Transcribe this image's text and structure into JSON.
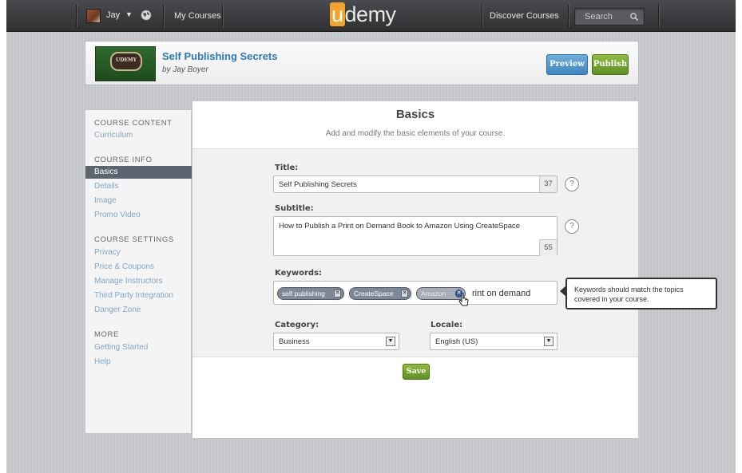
{
  "topbar": {
    "user_name": "Jay",
    "my_courses": "My Courses",
    "logo_u": "u",
    "logo_rest": "demy",
    "discover": "Discover Courses",
    "search_label": "Search"
  },
  "course": {
    "title": "Self Publishing Secrets",
    "author": "by Jay Boyer",
    "thumb_text": "UDEMY",
    "preview_label": "Preview",
    "publish_label": "Publish"
  },
  "sidebar": {
    "sections": [
      {
        "heading": "COURSE CONTENT",
        "items": [
          "Curriculum"
        ]
      },
      {
        "heading": "COURSE INFO",
        "items": [
          "Basics",
          "Details",
          "Image",
          "Promo Video"
        ]
      },
      {
        "heading": "COURSE SETTINGS",
        "items": [
          "Privacy",
          "Price & Coupons",
          "Manage Instructors",
          "Third Party Integration",
          "Danger Zone"
        ]
      },
      {
        "heading": "MORE",
        "items": [
          "Getting Started",
          "Help"
        ]
      }
    ],
    "active_item": "Basics"
  },
  "main": {
    "title": "Basics",
    "subtitle": "Add and modify the basic elements of your course.",
    "title_label": "Title:",
    "title_value": "Self Publishing Secrets",
    "title_count": "37",
    "subtitle_label": "Subtitle:",
    "subtitle_value": "How to Publish a Print on Demand Book to Amazon Using CreateSpace",
    "subtitle_count": "55",
    "keywords_label": "Keywords:",
    "keywords": [
      "self publishing",
      "CreateSpace",
      "Amazon"
    ],
    "keyword_typed": "rint on demand",
    "keywords_tooltip": "Keywords should match the topics covered in your course.",
    "category_label": "Category:",
    "category_value": "Business",
    "locale_label": "Locale:",
    "locale_value": "English (US)",
    "help_glyph": "?",
    "save_label": "Save"
  },
  "colors": {
    "link_blue": "#2c78b8",
    "green_button": "#6b9a2c",
    "blue_button": "#4c93c8",
    "logo_orange": "#f3a22b"
  }
}
